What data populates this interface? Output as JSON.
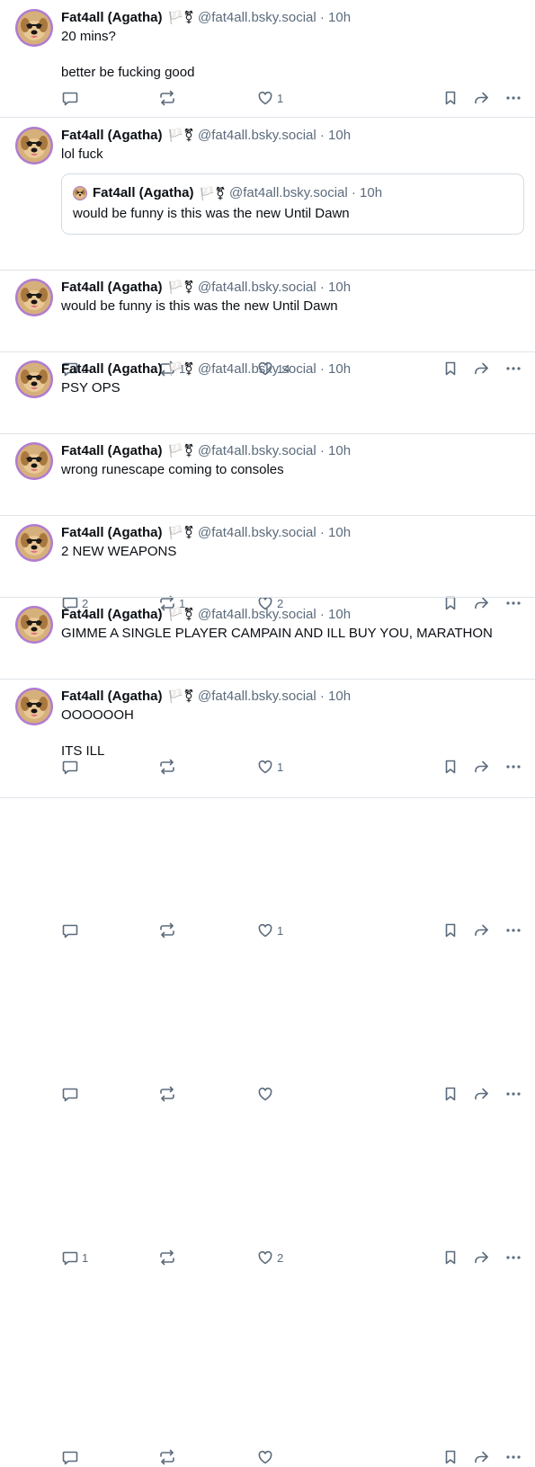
{
  "posts": [
    {
      "name": "Fat4all (Agatha)",
      "flags": "🏳️⚧",
      "handle": "@fat4all.bsky.social",
      "sep": "·",
      "time": "10h",
      "text": "20 mins?\n\nbetter be fucking good",
      "replies": "",
      "reposts": "",
      "likes": "1"
    },
    {
      "name": "Fat4all (Agatha)",
      "flags": "🏳️⚧",
      "handle": "@fat4all.bsky.social",
      "sep": "·",
      "time": "10h",
      "text": "lol fuck",
      "quote": {
        "name": "Fat4all (Agatha)",
        "flags": "🏳️⚧",
        "handle": "@fat4all.bsky.social",
        "sep": "·",
        "time": "10h",
        "text": "would be funny is this was the new Until Dawn"
      },
      "replies": "2",
      "reposts": "1",
      "likes": "14"
    },
    {
      "name": "Fat4all (Agatha)",
      "flags": "🏳️⚧",
      "handle": "@fat4all.bsky.social",
      "sep": "·",
      "time": "10h",
      "text": "would be funny is this was the new Until Dawn",
      "replies": "2",
      "reposts": "1",
      "likes": "2"
    },
    {
      "name": "Fat4all (Agatha)",
      "flags": "🏳️⚧",
      "handle": "@fat4all.bsky.social",
      "sep": "·",
      "time": "10h",
      "text": "PSY OPS",
      "replies": "",
      "reposts": "",
      "likes": "1"
    },
    {
      "name": "Fat4all (Agatha)",
      "flags": "🏳️⚧",
      "handle": "@fat4all.bsky.social",
      "sep": "·",
      "time": "10h",
      "text": "wrong runescape coming to consoles",
      "replies": "",
      "reposts": "",
      "likes": "1"
    },
    {
      "name": "Fat4all (Agatha)",
      "flags": "🏳️⚧",
      "handle": "@fat4all.bsky.social",
      "sep": "·",
      "time": "10h",
      "text": "2 NEW WEAPONS",
      "replies": "",
      "reposts": "",
      "likes": ""
    },
    {
      "name": "Fat4all (Agatha)",
      "flags": "🏳️⚧",
      "handle": "@fat4all.bsky.social",
      "sep": "·",
      "time": "10h",
      "text": "GIMME A SINGLE PLAYER CAMPAIN AND ILL BUY YOU, MARATHON",
      "replies": "1",
      "reposts": "",
      "likes": "2"
    },
    {
      "name": "Fat4all (Agatha)",
      "flags": "🏳️⚧",
      "handle": "@fat4all.bsky.social",
      "sep": "·",
      "time": "10h",
      "text": "OOOOOOH\n\nITS ILL",
      "replies": "",
      "reposts": "",
      "likes": ""
    }
  ],
  "icons": {
    "reply": "reply-icon",
    "repost": "repost-icon",
    "like": "heart-icon",
    "bookmark": "bookmark-icon",
    "share": "share-icon",
    "more": "more-icon"
  },
  "colors": {
    "text": "#0b0f14",
    "muted": "#5b6b7c",
    "divider": "#dfe4ea",
    "avatar_ring": "#b07cd0"
  }
}
